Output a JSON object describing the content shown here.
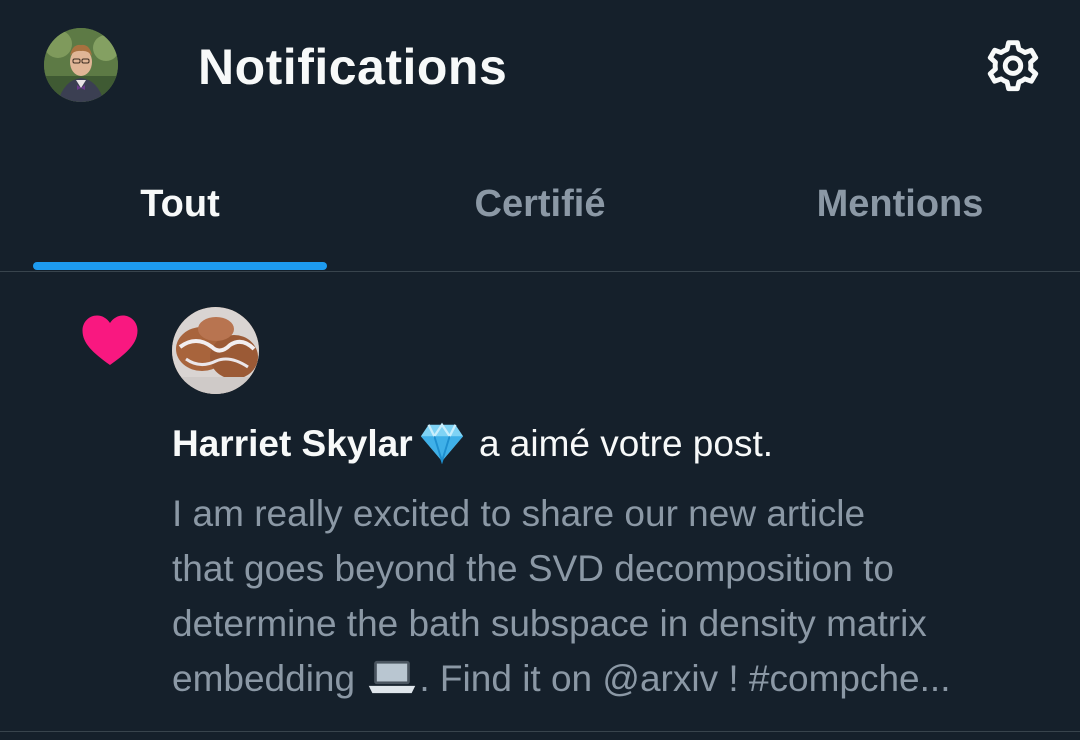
{
  "header": {
    "title": "Notifications",
    "avatar_icon": "user-avatar",
    "settings_icon": "gear-icon"
  },
  "tabs": [
    {
      "label": "Tout",
      "active": true
    },
    {
      "label": "Certifié",
      "active": false
    },
    {
      "label": "Mentions",
      "active": false
    }
  ],
  "notification": {
    "type_icon": "heart-icon",
    "user_name": "Harriet Skylar",
    "badge_icon": "gem-icon",
    "action_text": "a aimé votre post.",
    "post_lines": [
      "I am really excited to share our new article",
      "that goes beyond the SVD decomposition to",
      "determine the bath subspace in density matrix"
    ],
    "post_last_line_before_icon": "embedding ",
    "post_inline_icon": "laptop-icon",
    "post_last_line_after_icon": ". Find it on @arxiv ! #compche..."
  },
  "colors": {
    "background": "#15202b",
    "accent": "#1d9bf0",
    "heart": "#f91880",
    "muted_text": "#8b98a5",
    "divider": "#38444d"
  }
}
